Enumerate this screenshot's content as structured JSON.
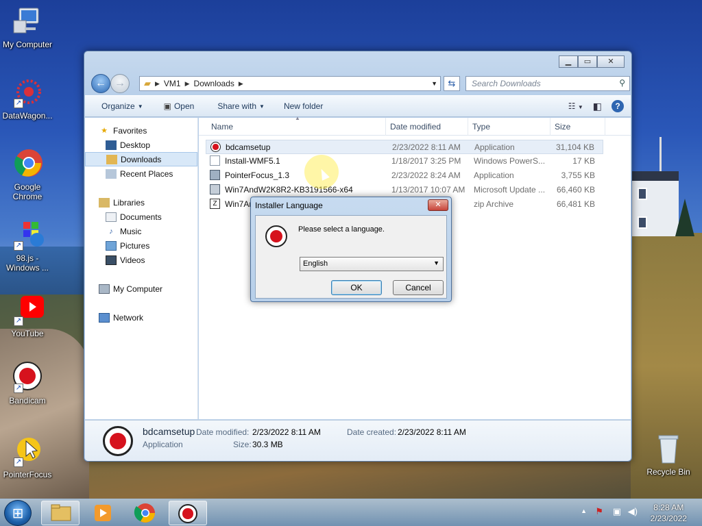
{
  "desktop": {
    "icons": [
      {
        "label": "My Computer"
      },
      {
        "label": "DataWagon..."
      },
      {
        "label": "Google Chrome"
      },
      {
        "label": "98.js - Windows ..."
      },
      {
        "label": "YouTube"
      },
      {
        "label": "Bandicam"
      },
      {
        "label": "PointerFocus"
      },
      {
        "label": "Recycle Bin"
      }
    ]
  },
  "explorer": {
    "breadcrumb": [
      "VM1",
      "Downloads"
    ],
    "search_placeholder": "Search Downloads",
    "toolbar": {
      "organize": "Organize",
      "open": "Open",
      "share_with": "Share with",
      "new_folder": "New folder"
    },
    "nav": {
      "favorites": "Favorites",
      "desktop": "Desktop",
      "downloads": "Downloads",
      "recent_places": "Recent Places",
      "libraries": "Libraries",
      "documents": "Documents",
      "music": "Music",
      "pictures": "Pictures",
      "videos": "Videos",
      "my_computer": "My Computer",
      "network": "Network"
    },
    "columns": {
      "name": "Name",
      "date": "Date modified",
      "type": "Type",
      "size": "Size"
    },
    "files": [
      {
        "name": "bdcamsetup",
        "date": "2/23/2022 8:11 AM",
        "type": "Application",
        "size": "31,104 KB"
      },
      {
        "name": "Install-WMF5.1",
        "date": "1/18/2017 3:25 PM",
        "type": "Windows PowerS...",
        "size": "17 KB"
      },
      {
        "name": "PointerFocus_1.3",
        "date": "2/23/2022 8:24 AM",
        "type": "Application",
        "size": "3,755 KB"
      },
      {
        "name": "Win7AndW2K8R2-KB3191566-x64",
        "date": "1/13/2017 10:07 AM",
        "type": "Microsoft Update ...",
        "size": "66,460 KB"
      },
      {
        "name": "Win7AndW2K8R2-KB3191566-x64",
        "date": "",
        "type": "zip Archive",
        "size": "66,481 KB"
      }
    ],
    "details": {
      "name": "bdcamsetup",
      "kind": "Application",
      "modified_label": "Date modified:",
      "modified": "2/23/2022 8:11 AM",
      "created_label": "Date created:",
      "created": "2/23/2022 8:11 AM",
      "size_label": "Size:",
      "size": "30.3 MB"
    }
  },
  "dialog": {
    "title": "Installer Language",
    "message": "Please select a language.",
    "selected_language": "English",
    "ok": "OK",
    "cancel": "Cancel"
  },
  "taskbar": {
    "time": "8:28 AM",
    "date": "2/23/2022"
  }
}
